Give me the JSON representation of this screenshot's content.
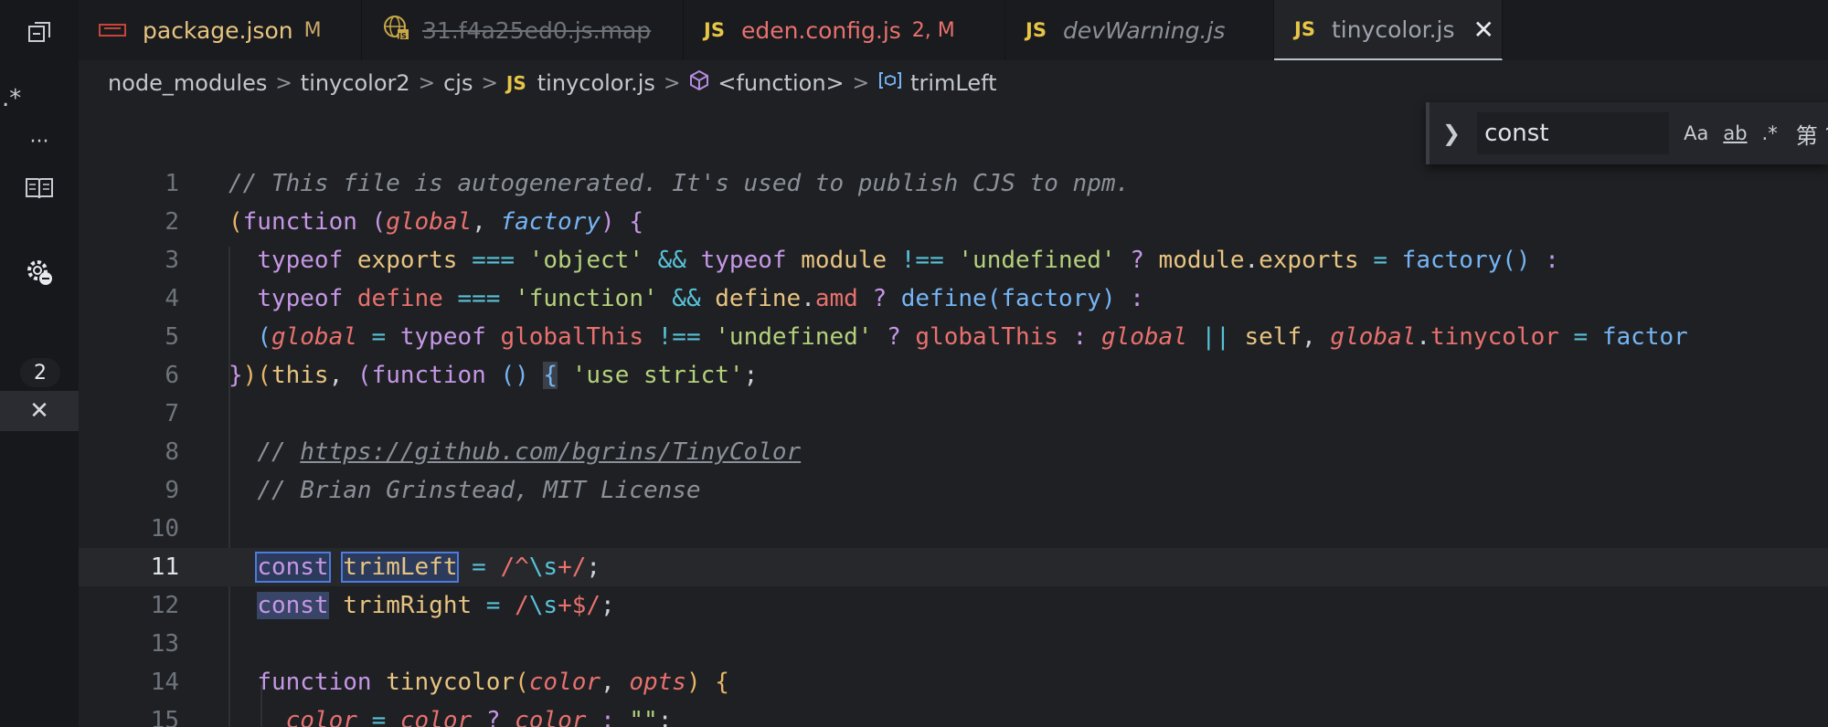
{
  "tabs": [
    {
      "label": "package.json",
      "modifier": "M",
      "icon": "npm-icon",
      "label_color": "#e8c481",
      "mod_color": "#c9a86a"
    },
    {
      "label": "31.f4a25ed0.js.map",
      "modifier": "",
      "icon": "globe-js-icon",
      "label_color": "#6e7379"
    },
    {
      "label": "eden.config.js",
      "modifier": "2, M",
      "icon": "js-icon",
      "label_color": "#e8716f",
      "mod_color": "#e8716f"
    },
    {
      "label": "devWarning.js",
      "modifier": "",
      "icon": "js-icon",
      "label_color": "#8b9099"
    },
    {
      "label": "tinycolor.js",
      "modifier": "",
      "icon": "js-icon",
      "label_color": "#9ea4ac",
      "active": true
    }
  ],
  "js_badge": "JS",
  "breadcrumb": {
    "items": [
      "node_modules",
      "tinycolor2",
      "cjs",
      "tinycolor.js",
      "<function>",
      "trimLeft"
    ],
    "separator": ">"
  },
  "activity": {
    "badge_count": "2",
    "regex_glyph": ".*",
    "more_glyph": "···",
    "close_glyph": "✕"
  },
  "find": {
    "query": "const",
    "case_label": "Aa",
    "word_label": "ab",
    "regex_label": ".*",
    "result_label": "第 ?"
  },
  "editor": {
    "line_numbers": [
      "1",
      "2",
      "3",
      "4",
      "5",
      "6",
      "7",
      "8",
      "9",
      "10",
      "11",
      "12",
      "13",
      "14",
      "15"
    ],
    "current_line": "11"
  },
  "colors": {
    "background": "#1f2023",
    "keyword": "#c597e6",
    "function": "#75b5f5",
    "string": "#b4d17c",
    "comment": "#8b9099",
    "highlight": "#4c7cdd"
  }
}
